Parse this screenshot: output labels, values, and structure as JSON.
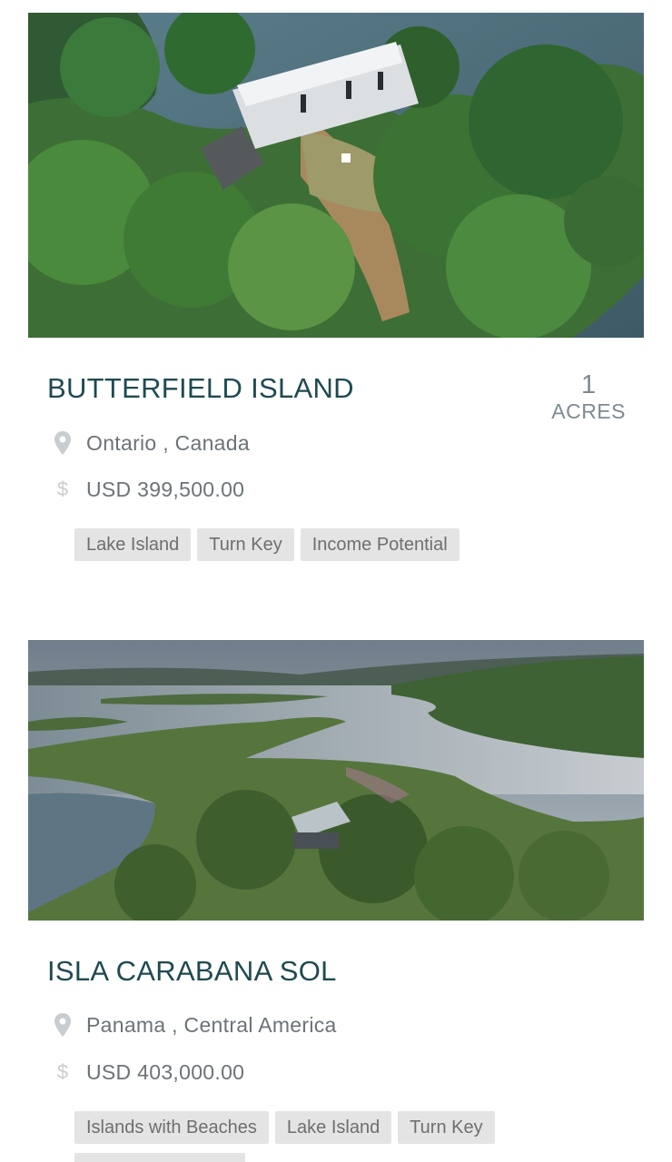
{
  "listings": [
    {
      "title": "BUTTERFIELD ISLAND",
      "acres_value": "1",
      "acres_unit": "ACRES",
      "location": "Ontario , Canada",
      "currency_symbol": "$",
      "price": "USD 399,500.00",
      "tags": [
        "Lake Island",
        "Turn Key",
        "Income Potential"
      ],
      "photo_icon": "aerial-photo-house-on-forested-island"
    },
    {
      "title": "ISLA CARABANA SOL",
      "location": "Panama , Central America",
      "currency_symbol": "$",
      "price": "USD 403,000.00",
      "tags": [
        "Islands with Beaches",
        "Lake Island",
        "Turn Key"
      ],
      "photo_icon": "aerial-photo-mangrove-island-with-house"
    }
  ],
  "icons": {
    "location": "map-pin-icon",
    "price": "dollar-icon"
  },
  "colors": {
    "title": "#1e4a4f",
    "text": "#6b7378",
    "icon": "#c9cdd0",
    "tag_bg": "#e4e4e4",
    "tag_text": "#6e6e6e"
  }
}
